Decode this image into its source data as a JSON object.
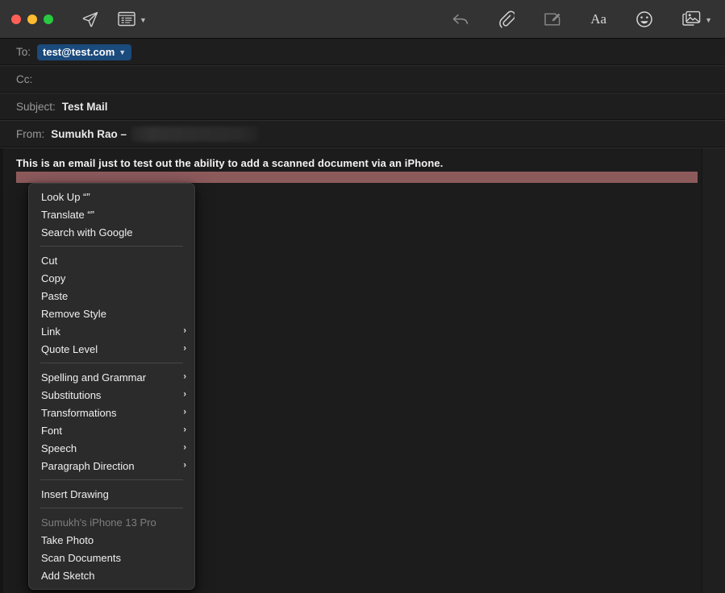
{
  "window": {
    "traffic_lights": [
      {
        "name": "close",
        "color": "#ff5f57"
      },
      {
        "name": "minimize",
        "color": "#febc2e"
      },
      {
        "name": "zoom",
        "color": "#28c840"
      }
    ]
  },
  "toolbar": {
    "left_icons": [
      {
        "name": "send-icon",
        "label": "Send"
      },
      {
        "name": "stationery-icon",
        "label": "Stationery",
        "has_chevron": true
      }
    ],
    "right_icons": [
      {
        "name": "reply-arrow-icon",
        "label": "Reply"
      },
      {
        "name": "paperclip-icon",
        "label": "Attach"
      },
      {
        "name": "markup-icon",
        "label": "Markup"
      },
      {
        "name": "font-aa-icon",
        "label": "Aa"
      },
      {
        "name": "emoji-icon",
        "label": "Emoji & Symbols"
      },
      {
        "name": "photos-icon",
        "label": "Photo Browser",
        "has_chevron": true
      }
    ]
  },
  "headers": {
    "to": {
      "label": "To:",
      "recipient": "test@test.com",
      "chevron": "⌄"
    },
    "cc": {
      "label": "Cc:",
      "value": ""
    },
    "subject": {
      "label": "Subject:",
      "value": "Test Mail"
    },
    "from": {
      "label": "From:",
      "value": "Sumukh Rao –",
      "redacted": true
    }
  },
  "body": {
    "text": "This is an email just to test out the ability to add a scanned document via an iPhone.",
    "selection_color": "#8d5a5c"
  },
  "context_menu": {
    "sections": [
      {
        "items": [
          {
            "label": "Look Up “”",
            "submenu": false,
            "disabled": false
          },
          {
            "label": "Translate “”",
            "submenu": false,
            "disabled": false
          },
          {
            "label": "Search with Google",
            "submenu": false,
            "disabled": false
          }
        ]
      },
      {
        "items": [
          {
            "label": "Cut",
            "submenu": false,
            "disabled": false
          },
          {
            "label": "Copy",
            "submenu": false,
            "disabled": false
          },
          {
            "label": "Paste",
            "submenu": false,
            "disabled": false
          },
          {
            "label": "Remove Style",
            "submenu": false,
            "disabled": false
          },
          {
            "label": "Link",
            "submenu": true,
            "disabled": false
          },
          {
            "label": "Quote Level",
            "submenu": true,
            "disabled": false
          }
        ]
      },
      {
        "items": [
          {
            "label": "Spelling and Grammar",
            "submenu": true,
            "disabled": false
          },
          {
            "label": "Substitutions",
            "submenu": true,
            "disabled": false
          },
          {
            "label": "Transformations",
            "submenu": true,
            "disabled": false
          },
          {
            "label": "Font",
            "submenu": true,
            "disabled": false
          },
          {
            "label": "Speech",
            "submenu": true,
            "disabled": false
          },
          {
            "label": "Paragraph Direction",
            "submenu": true,
            "disabled": false
          }
        ]
      },
      {
        "items": [
          {
            "label": "Insert Drawing",
            "submenu": false,
            "disabled": false
          }
        ]
      },
      {
        "items": [
          {
            "label": "Sumukh's iPhone 13 Pro",
            "submenu": false,
            "disabled": true
          },
          {
            "label": "Take Photo",
            "submenu": false,
            "disabled": false
          },
          {
            "label": "Scan Documents",
            "submenu": false,
            "disabled": false
          },
          {
            "label": "Add Sketch",
            "submenu": false,
            "disabled": false
          }
        ]
      }
    ],
    "submenu_arrow": "›"
  }
}
